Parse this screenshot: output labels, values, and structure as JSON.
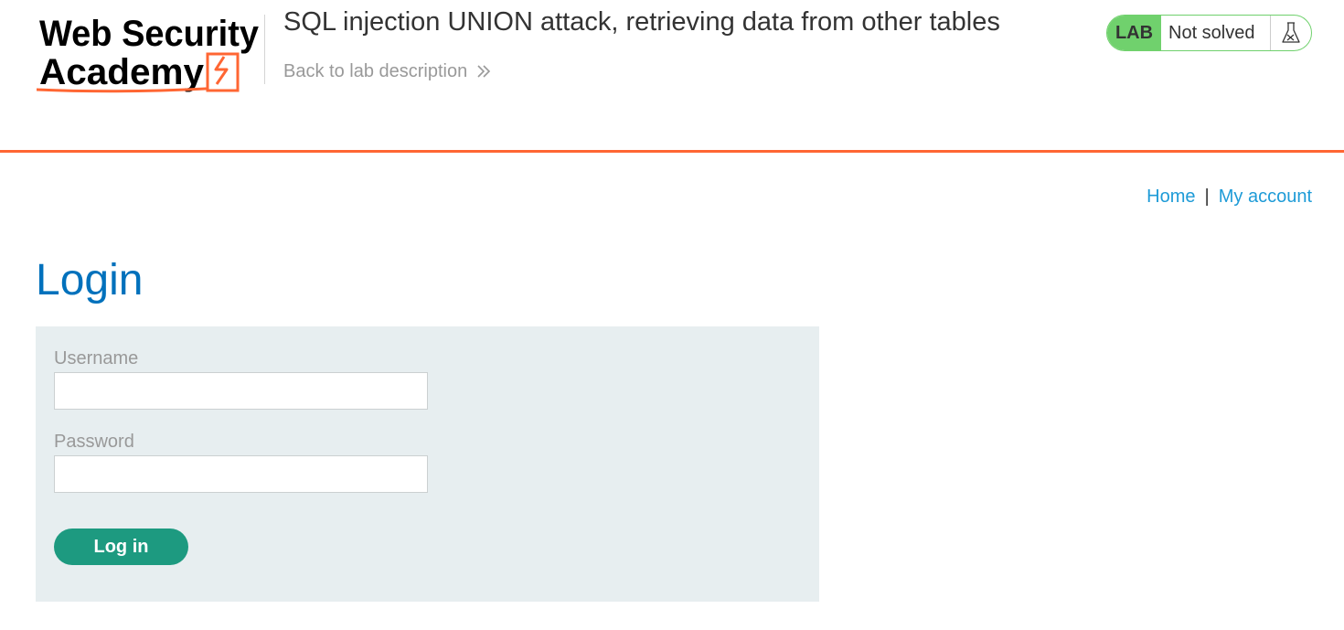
{
  "header": {
    "logo_text": "Web Security Academy",
    "lab_title": "SQL injection UNION attack, retrieving data from other tables",
    "back_link_label": "Back to lab description",
    "lab_badge": "LAB",
    "lab_status": "Not solved",
    "lab_status_icon": "flask-icon"
  },
  "nav": {
    "home_label": "Home",
    "separator": "|",
    "account_label": "My account"
  },
  "page": {
    "title": "Login"
  },
  "form": {
    "username_label": "Username",
    "username_value": "",
    "password_label": "Password",
    "password_value": "",
    "submit_label": "Log in"
  },
  "colors": {
    "accent_orange": "#ff6633",
    "lab_green": "#70d16d",
    "title_blue": "#0071bc",
    "link_blue": "#1e9bd7",
    "button_green": "#1d9a80",
    "form_bg": "#e7eef0"
  }
}
